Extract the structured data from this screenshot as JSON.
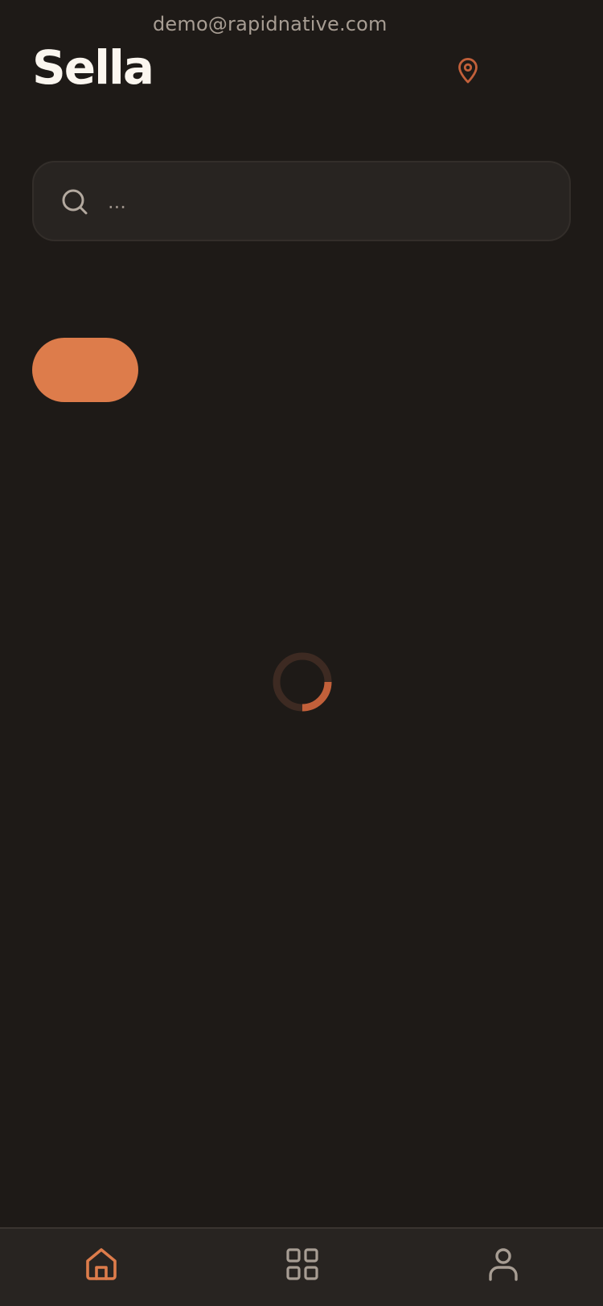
{
  "header": {
    "account_email": "demo@rapidnative.com",
    "app_title": "Sella",
    "location_icon": "map-pin-icon"
  },
  "search": {
    "placeholder": "...",
    "value": "",
    "icon": "search-icon"
  },
  "filters": {
    "chip_label": ""
  },
  "loading": {
    "progress_fraction": 0.25
  },
  "bottom_nav": {
    "items": [
      {
        "icon": "home-icon",
        "active": true
      },
      {
        "icon": "grid-icon",
        "active": false
      },
      {
        "icon": "user-icon",
        "active": false
      }
    ]
  },
  "colors": {
    "background": "#1e1a17",
    "surface": "#282421",
    "accent": "#dd7c4b",
    "accent_dark": "#c2603a",
    "text_primary": "#fbf6ef",
    "text_muted": "#a79d93"
  }
}
